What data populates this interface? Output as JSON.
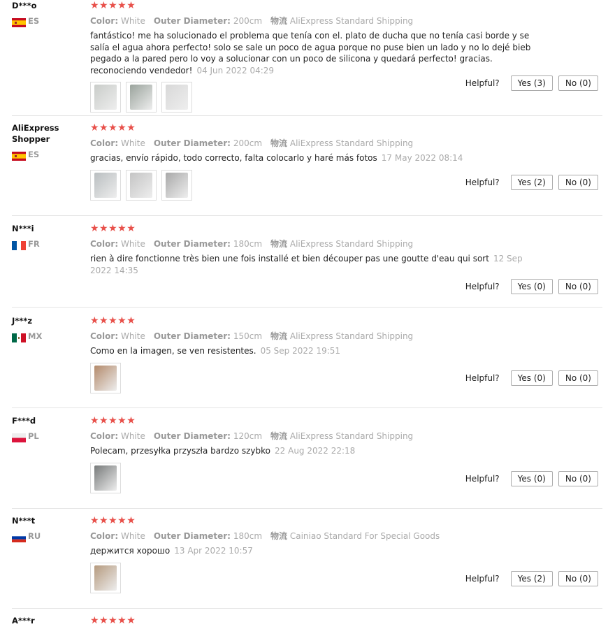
{
  "labels": {
    "color": "Color:",
    "outer_diameter": "Outer Diameter:",
    "shipping": "物流",
    "helpful": "Helpful?"
  },
  "star_color": "#e8504a",
  "reviews": [
    {
      "user": "D***o",
      "country": "ES",
      "flag": "flag-spain-icon",
      "stars": "★★★★★",
      "color": "White",
      "diameter": "200cm",
      "shipping": "AliExpress Standard Shipping",
      "text": "fantástico! me ha solucionado el problema que tenía con el. plato de ducha que no tenía casi borde y se salía el agua ahora perfecto! solo se sale un poco de agua porque no puse bien un lado y no lo dejé bieb pegado a la pared pero lo voy a solucionar con un poco de silicona y quedará perfecto! gracias. reconociendo vendedor!",
      "date": "04 Jun 2022 04:29",
      "photos": 3,
      "yes": "Yes (3)",
      "no": "No (0)"
    },
    {
      "user": "AliExpress Shopper",
      "country": "ES",
      "flag": "flag-spain-icon",
      "stars": "★★★★★",
      "color": "White",
      "diameter": "200cm",
      "shipping": "AliExpress Standard Shipping",
      "text": "gracias, envío rápido, todo correcto, falta colocarlo y haré más fotos",
      "date": "17 May 2022 08:14",
      "photos": 3,
      "yes": "Yes (2)",
      "no": "No (0)"
    },
    {
      "user": "N***i",
      "country": "FR",
      "flag": "flag-france-icon",
      "stars": "★★★★★",
      "color": "White",
      "diameter": "180cm",
      "shipping": "AliExpress Standard Shipping",
      "text": "rien à dire fonctionne très bien une fois installé et bien découper pas une goutte d'eau qui sort",
      "date": "12 Sep 2022 14:35",
      "photos": 0,
      "yes": "Yes (0)",
      "no": "No (0)"
    },
    {
      "user": "J***z",
      "country": "MX",
      "flag": "flag-mexico-icon",
      "stars": "★★★★★",
      "color": "White",
      "diameter": "150cm",
      "shipping": "AliExpress Standard Shipping",
      "text": "Como en la imagen, se ven resistentes.",
      "date": "05 Sep 2022 19:51",
      "photos": 1,
      "yes": "Yes (0)",
      "no": "No (0)"
    },
    {
      "user": "F***d",
      "country": "PL",
      "flag": "flag-poland-icon",
      "stars": "★★★★★",
      "color": "White",
      "diameter": "120cm",
      "shipping": "AliExpress Standard Shipping",
      "text": "Polecam, przesyłka przyszła bardzo szybko",
      "date": "22 Aug 2022 22:18",
      "photos": 1,
      "yes": "Yes (0)",
      "no": "No (0)"
    },
    {
      "user": "N***t",
      "country": "RU",
      "flag": "flag-russia-icon",
      "stars": "★★★★★",
      "color": "White",
      "diameter": "180cm",
      "shipping": "Cainiao Standard For Special Goods",
      "text": "держится хорошо",
      "date": "13 Apr 2022 10:57",
      "photos": 1,
      "yes": "Yes (2)",
      "no": "No (0)"
    },
    {
      "user": "A***r",
      "country": "",
      "flag": "",
      "stars": "★★★★★",
      "color": "",
      "diameter": "",
      "shipping": "",
      "text": "",
      "date": "",
      "photos": 0,
      "yes": "",
      "no": ""
    }
  ]
}
